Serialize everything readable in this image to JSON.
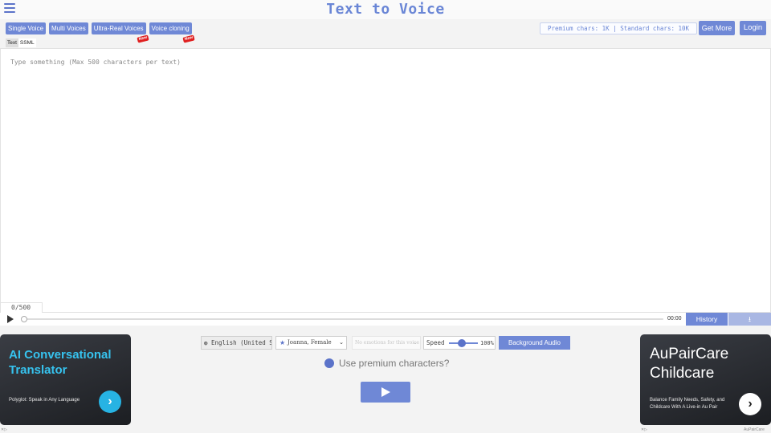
{
  "header": {
    "title": "Text to Voice"
  },
  "modes": {
    "items": [
      {
        "label": "Single Voice",
        "badge": ""
      },
      {
        "label": "Multi Voices",
        "badge": ""
      },
      {
        "label": "Ultra-Real Voices",
        "badge": "New"
      },
      {
        "label": "Voice cloning",
        "badge": "New"
      }
    ]
  },
  "quota": {
    "text": "Premium chars: 1K | Standard chars: 10K"
  },
  "auth": {
    "get_more": "Get More",
    "login": "Login"
  },
  "editor_tabs": [
    "Text",
    "SSML"
  ],
  "editor": {
    "placeholder": "Type something (Max 500 characters per text)",
    "counter": "0/500"
  },
  "player": {
    "time": "00:00",
    "history": "History",
    "download_icon": "download-icon"
  },
  "settings": {
    "language": "English (United States)",
    "voice": "Joanna, Female",
    "emotion": "No emotions for this voice",
    "speed_label": "Speed",
    "speed_value": "100%",
    "background_audio": "Background Audio",
    "premium_question": "Use premium characters?"
  },
  "ads": {
    "left": {
      "title": "AI Conversational Translator",
      "subtitle": "Polyglot: Speak in Any Language",
      "cta": "›"
    },
    "right": {
      "title": "AuPairCare Childcare",
      "subtitle": "Balance Family Needs, Safety, and Childcare With A Live-in Au Pair",
      "cta": "›",
      "brand": "AuPairCare"
    }
  },
  "colors": {
    "accent": "#6f88d6",
    "title": "#6a86d6",
    "badge": "#e02020"
  }
}
